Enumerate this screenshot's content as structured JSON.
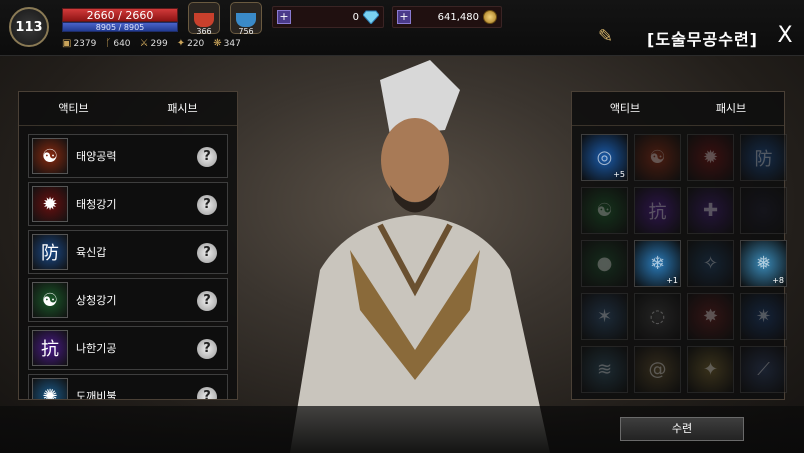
{
  "header": {
    "level": "113",
    "hp": "2660 / 2660",
    "mp": "8905 / 8905",
    "stats": [
      "2379",
      "640",
      "299",
      "220",
      "347"
    ],
    "potions": [
      {
        "count": "366",
        "color": "#c8402c"
      },
      {
        "count": "756",
        "color": "#3a8ac8"
      }
    ],
    "gems": "0",
    "gold": "641,480",
    "title": "[도술무공수련]",
    "close_label": "X"
  },
  "left_panel": {
    "tabs": [
      "액티브",
      "패시브"
    ],
    "skills": [
      {
        "name": "태양공력",
        "icon": "yin-yang-fire-icon",
        "bg": "#8a2a10"
      },
      {
        "name": "태청강기",
        "icon": "red-seal-icon",
        "bg": "#6a1010"
      },
      {
        "name": "육신갑",
        "icon": "shield-glyph-icon",
        "bg": "#1a4a8a"
      },
      {
        "name": "상청강기",
        "icon": "green-yin-yang-icon",
        "bg": "#1a5a2a"
      },
      {
        "name": "나한기공",
        "icon": "purple-glyph-icon",
        "bg": "#4a1a8a"
      },
      {
        "name": "도깨비불",
        "icon": "blue-flame-icon",
        "bg": "#1a5a8a"
      }
    ]
  },
  "right_panel": {
    "tabs": [
      "액티브",
      "패시브"
    ],
    "cells": [
      {
        "icon": "water-orb-icon",
        "bg": "#1a5aa8",
        "level": "+5",
        "dim": false
      },
      {
        "icon": "yin-yang-fire-icon",
        "bg": "#8a2a10",
        "level": "",
        "dim": true
      },
      {
        "icon": "red-seal-icon",
        "bg": "#6a1010",
        "level": "",
        "dim": true
      },
      {
        "icon": "shield-glyph-icon",
        "bg": "#1a4a8a",
        "level": "",
        "dim": true
      },
      {
        "icon": "green-yin-yang-icon",
        "bg": "#1a5a2a",
        "level": "",
        "dim": true
      },
      {
        "icon": "purple-glyph-icon",
        "bg": "#4a1a8a",
        "level": "",
        "dim": true
      },
      {
        "icon": "purple-cross-icon",
        "bg": "#3a1a6a",
        "level": "",
        "dim": true
      },
      {
        "icon": "blank-icon",
        "bg": "#1a1a2a",
        "level": "",
        "dim": true
      },
      {
        "icon": "green-orb-icon",
        "bg": "#1a4a2a",
        "level": "",
        "dim": true
      },
      {
        "icon": "ice-lotus-icon",
        "bg": "#2a7ab8",
        "level": "+1",
        "dim": false
      },
      {
        "icon": "blue-swirl-icon",
        "bg": "#1a3a5a",
        "level": "",
        "dim": true
      },
      {
        "icon": "ice-shards-icon",
        "bg": "#3a8ab8",
        "level": "+8",
        "dim": false
      },
      {
        "icon": "ice-crystal-icon",
        "bg": "#2a4a6a",
        "level": "",
        "dim": true
      },
      {
        "icon": "grey-swirl-icon",
        "bg": "#3a3a3a",
        "level": "",
        "dim": true
      },
      {
        "icon": "red-explosion-icon",
        "bg": "#5a1a1a",
        "level": "",
        "dim": true
      },
      {
        "icon": "blue-burst-icon",
        "bg": "#1a3a6a",
        "level": "",
        "dim": true
      },
      {
        "icon": "wind-slash-icon",
        "bg": "#2a4a5a",
        "level": "",
        "dim": true
      },
      {
        "icon": "vortex-icon",
        "bg": "#5a4a2a",
        "level": "",
        "dim": true
      },
      {
        "icon": "golden-strike-icon",
        "bg": "#6a5a2a",
        "level": "",
        "dim": true
      },
      {
        "icon": "blue-slash-icon",
        "bg": "#2a3a5a",
        "level": "",
        "dim": true
      }
    ]
  },
  "footer": {
    "train_label": "수련"
  }
}
